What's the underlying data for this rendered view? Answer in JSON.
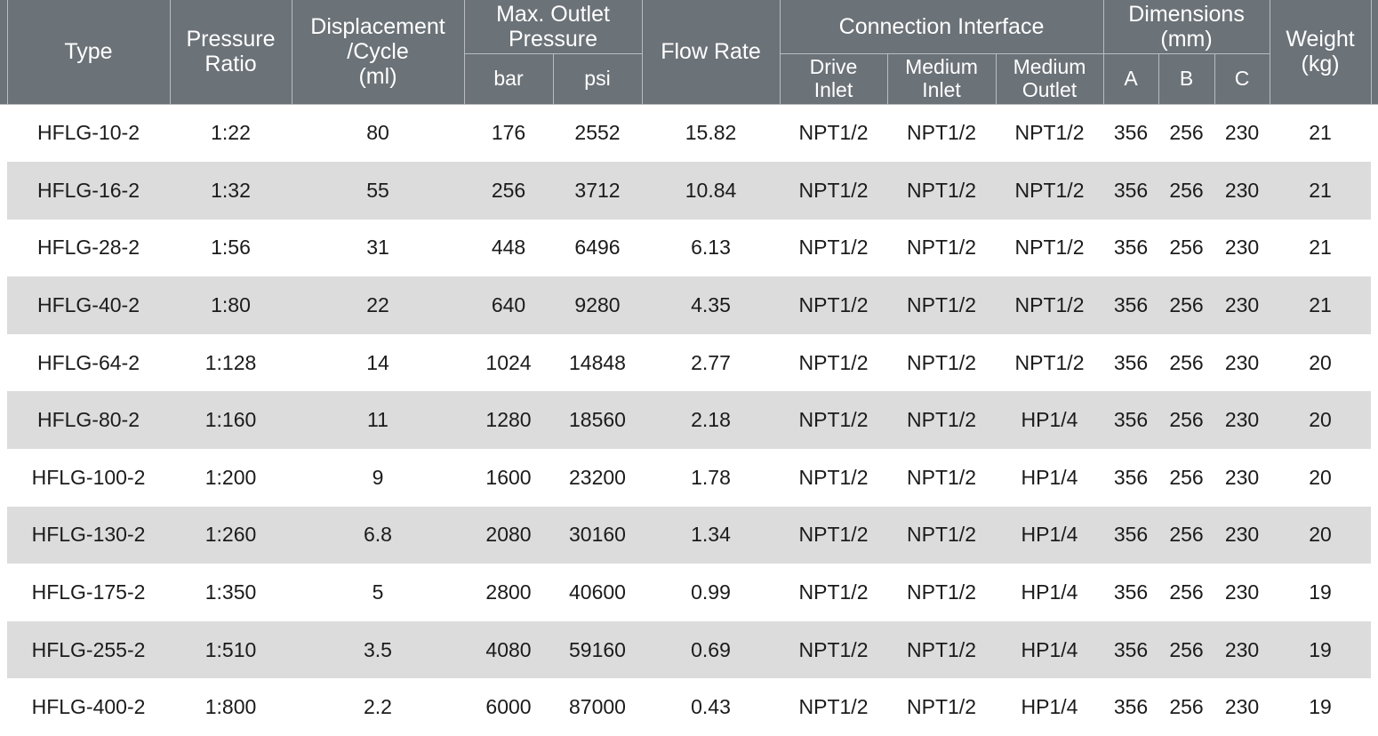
{
  "table": {
    "header": {
      "type": "Type",
      "pressure_ratio": "Pressure\nRatio",
      "pressure_ratio_l1": "Pressure",
      "pressure_ratio_l2": "Ratio",
      "displacement_l1": "Displacement",
      "displacement_l2": "/Cycle",
      "displacement_l3": "(ml)",
      "max_outlet_pressure_l1": "Max. Outlet",
      "max_outlet_pressure_l2": "Pressure",
      "bar": "bar",
      "psi": "psi",
      "flow_rate": "Flow Rate",
      "connection_interface": "Connection Interface",
      "drive_inlet_l1": "Drive",
      "drive_inlet_l2": "Inlet",
      "medium_inlet_l1": "Medium",
      "medium_inlet_l2": "Inlet",
      "medium_outlet_l1": "Medium",
      "medium_outlet_l2": "Outlet",
      "dimensions_l1": "Dimensions",
      "dimensions_l2": "(mm)",
      "dim_a": "A",
      "dim_b": "B",
      "dim_c": "C",
      "weight_l1": "Weight",
      "weight_l2": "(kg)"
    },
    "colors": {
      "header_bg": "#6b7278",
      "header_text": "#ffffff",
      "header_rule": "#b9bdc1",
      "row_alt_bg": "#dcdcdc",
      "row_bg": "#ffffff",
      "body_text": "#1b1b1b"
    },
    "rows": [
      {
        "type": "HFLG-10-2",
        "pressure_ratio": "1:22",
        "displacement": "80",
        "bar": "176",
        "psi": "2552",
        "flow_rate": "15.82",
        "drive_inlet": "NPT1/2",
        "medium_inlet": "NPT1/2",
        "medium_outlet": "NPT1/2",
        "a": "356",
        "b": "256",
        "c": "230",
        "weight": "21"
      },
      {
        "type": "HFLG-16-2",
        "pressure_ratio": "1:32",
        "displacement": "55",
        "bar": "256",
        "psi": "3712",
        "flow_rate": "10.84",
        "drive_inlet": "NPT1/2",
        "medium_inlet": "NPT1/2",
        "medium_outlet": "NPT1/2",
        "a": "356",
        "b": "256",
        "c": "230",
        "weight": "21"
      },
      {
        "type": "HFLG-28-2",
        "pressure_ratio": "1:56",
        "displacement": "31",
        "bar": "448",
        "psi": "6496",
        "flow_rate": "6.13",
        "drive_inlet": "NPT1/2",
        "medium_inlet": "NPT1/2",
        "medium_outlet": "NPT1/2",
        "a": "356",
        "b": "256",
        "c": "230",
        "weight": "21"
      },
      {
        "type": "HFLG-40-2",
        "pressure_ratio": "1:80",
        "displacement": "22",
        "bar": "640",
        "psi": "9280",
        "flow_rate": "4.35",
        "drive_inlet": "NPT1/2",
        "medium_inlet": "NPT1/2",
        "medium_outlet": "NPT1/2",
        "a": "356",
        "b": "256",
        "c": "230",
        "weight": "21"
      },
      {
        "type": "HFLG-64-2",
        "pressure_ratio": "1:128",
        "displacement": "14",
        "bar": "1024",
        "psi": "14848",
        "flow_rate": "2.77",
        "drive_inlet": "NPT1/2",
        "medium_inlet": "NPT1/2",
        "medium_outlet": "NPT1/2",
        "a": "356",
        "b": "256",
        "c": "230",
        "weight": "20"
      },
      {
        "type": "HFLG-80-2",
        "pressure_ratio": "1:160",
        "displacement": "11",
        "bar": "1280",
        "psi": "18560",
        "flow_rate": "2.18",
        "drive_inlet": "NPT1/2",
        "medium_inlet": "NPT1/2",
        "medium_outlet": "HP1/4",
        "a": "356",
        "b": "256",
        "c": "230",
        "weight": "20"
      },
      {
        "type": "HFLG-100-2",
        "pressure_ratio": "1:200",
        "displacement": "9",
        "bar": "1600",
        "psi": "23200",
        "flow_rate": "1.78",
        "drive_inlet": "NPT1/2",
        "medium_inlet": "NPT1/2",
        "medium_outlet": "HP1/4",
        "a": "356",
        "b": "256",
        "c": "230",
        "weight": "20"
      },
      {
        "type": "HFLG-130-2",
        "pressure_ratio": "1:260",
        "displacement": "6.8",
        "bar": "2080",
        "psi": "30160",
        "flow_rate": "1.34",
        "drive_inlet": "NPT1/2",
        "medium_inlet": "NPT1/2",
        "medium_outlet": "HP1/4",
        "a": "356",
        "b": "256",
        "c": "230",
        "weight": "20"
      },
      {
        "type": "HFLG-175-2",
        "pressure_ratio": "1:350",
        "displacement": "5",
        "bar": "2800",
        "psi": "40600",
        "flow_rate": "0.99",
        "drive_inlet": "NPT1/2",
        "medium_inlet": "NPT1/2",
        "medium_outlet": "HP1/4",
        "a": "356",
        "b": "256",
        "c": "230",
        "weight": "19"
      },
      {
        "type": "HFLG-255-2",
        "pressure_ratio": "1:510",
        "displacement": "3.5",
        "bar": "4080",
        "psi": "59160",
        "flow_rate": "0.69",
        "drive_inlet": "NPT1/2",
        "medium_inlet": "NPT1/2",
        "medium_outlet": "HP1/4",
        "a": "356",
        "b": "256",
        "c": "230",
        "weight": "19"
      },
      {
        "type": "HFLG-400-2",
        "pressure_ratio": "1:800",
        "displacement": "2.2",
        "bar": "6000",
        "psi": "87000",
        "flow_rate": "0.43",
        "drive_inlet": "NPT1/2",
        "medium_inlet": "NPT1/2",
        "medium_outlet": "HP1/4",
        "a": "356",
        "b": "256",
        "c": "230",
        "weight": "19"
      }
    ]
  }
}
